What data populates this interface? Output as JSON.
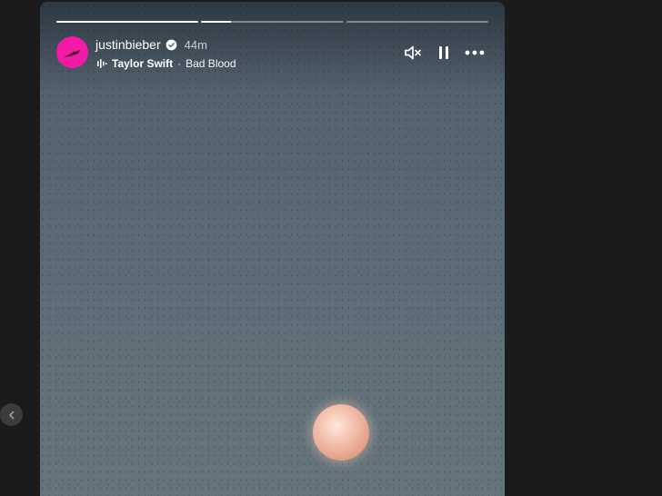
{
  "story": {
    "progress": [
      {
        "fraction": 1.0
      },
      {
        "fraction": 0.21
      },
      {
        "fraction": 0.0
      }
    ],
    "user": {
      "username": "justinbieber",
      "verified": true,
      "time": "44m",
      "avatar_color": "#f21aa6"
    },
    "music": {
      "artist": "Taylor Swift",
      "separator": "·",
      "song": "Bad Blood"
    },
    "controls": [
      {
        "icon": "volume-muted-icon"
      },
      {
        "icon": "pause-icon"
      },
      {
        "icon": "more-options-icon"
      }
    ]
  },
  "navigation": {
    "previous_icon": "chevron-left-icon"
  }
}
